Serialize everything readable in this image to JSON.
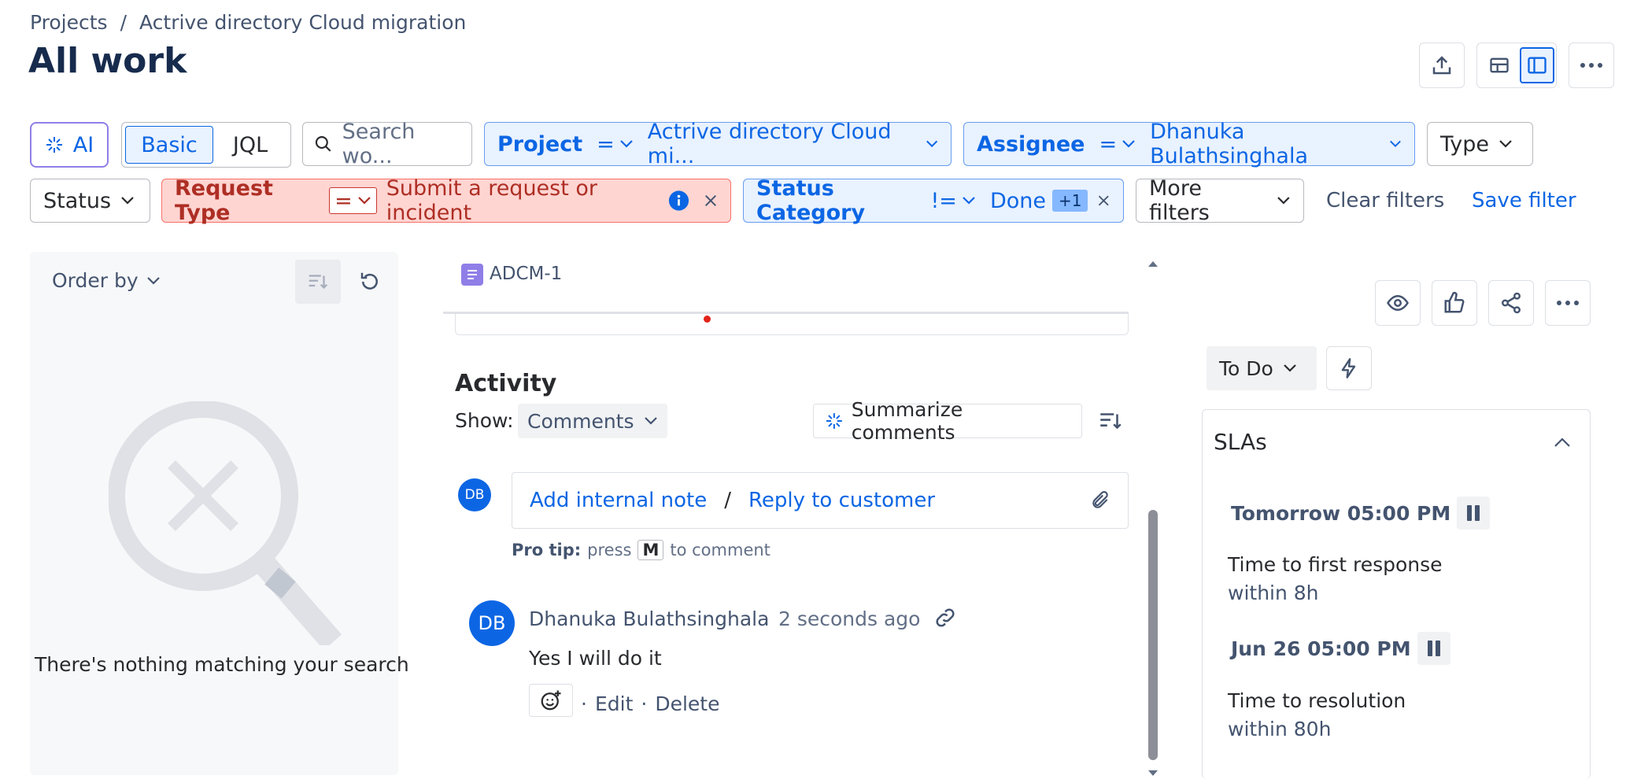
{
  "breadcrumb": {
    "root": "Projects",
    "sep": "/",
    "project": "Actrive directory Cloud migration"
  },
  "page": {
    "title": "All work"
  },
  "filters": {
    "ai_label": "AI",
    "basic_label": "Basic",
    "jql_label": "JQL",
    "search_placeholder": "Search wo...",
    "project": {
      "field": "Project",
      "op": "=",
      "value": "Actrive directory Cloud mi..."
    },
    "assignee": {
      "field": "Assignee",
      "op": "=",
      "value": "Dhanuka Bulathsinghala"
    },
    "type_label": "Type",
    "status_label": "Status",
    "request_type": {
      "field": "Request Type",
      "op": "=",
      "value": "Submit a request or incident"
    },
    "status_category": {
      "field": "Status Category",
      "op": "!=",
      "value": "Done",
      "extra": "+1"
    },
    "more_filters": "More filters",
    "clear_filters": "Clear filters",
    "save_filter": "Save filter"
  },
  "list_panel": {
    "order_by": "Order by",
    "empty_message": "There's nothing matching your search"
  },
  "issue": {
    "key": "ADCM-1",
    "activity": {
      "heading": "Activity",
      "show_label": "Show:",
      "show_value": "Comments",
      "summarize": "Summarize comments",
      "current_user_initials": "DB",
      "add_internal_note": "Add internal note",
      "slash": "/",
      "reply_to_customer": "Reply to customer",
      "pro_tip_label": "Pro tip:",
      "pro_tip_press": "press",
      "pro_tip_key": "M",
      "pro_tip_suffix": "to comment"
    },
    "comment": {
      "initials": "DB",
      "author": "Dhanuka Bulathsinghala",
      "time": "2 seconds ago",
      "body": "Yes I will do it",
      "dot": "·",
      "edit": "Edit",
      "delete": "Delete"
    }
  },
  "details": {
    "status_value": "To Do",
    "sla": {
      "heading": "SLAs",
      "items": [
        {
          "due": "Tomorrow 05:00 PM",
          "name": "Time to first response",
          "goal": "within 8h"
        },
        {
          "due": "Jun 26 05:00 PM",
          "name": "Time to resolution",
          "goal": "within 80h"
        }
      ]
    }
  },
  "colors": {
    "accent": "#0c66e4",
    "avatar": "#0c66e4",
    "red_filter_bg": "#ffd5d2",
    "blue_filter_bg": "#e9f2ff"
  }
}
